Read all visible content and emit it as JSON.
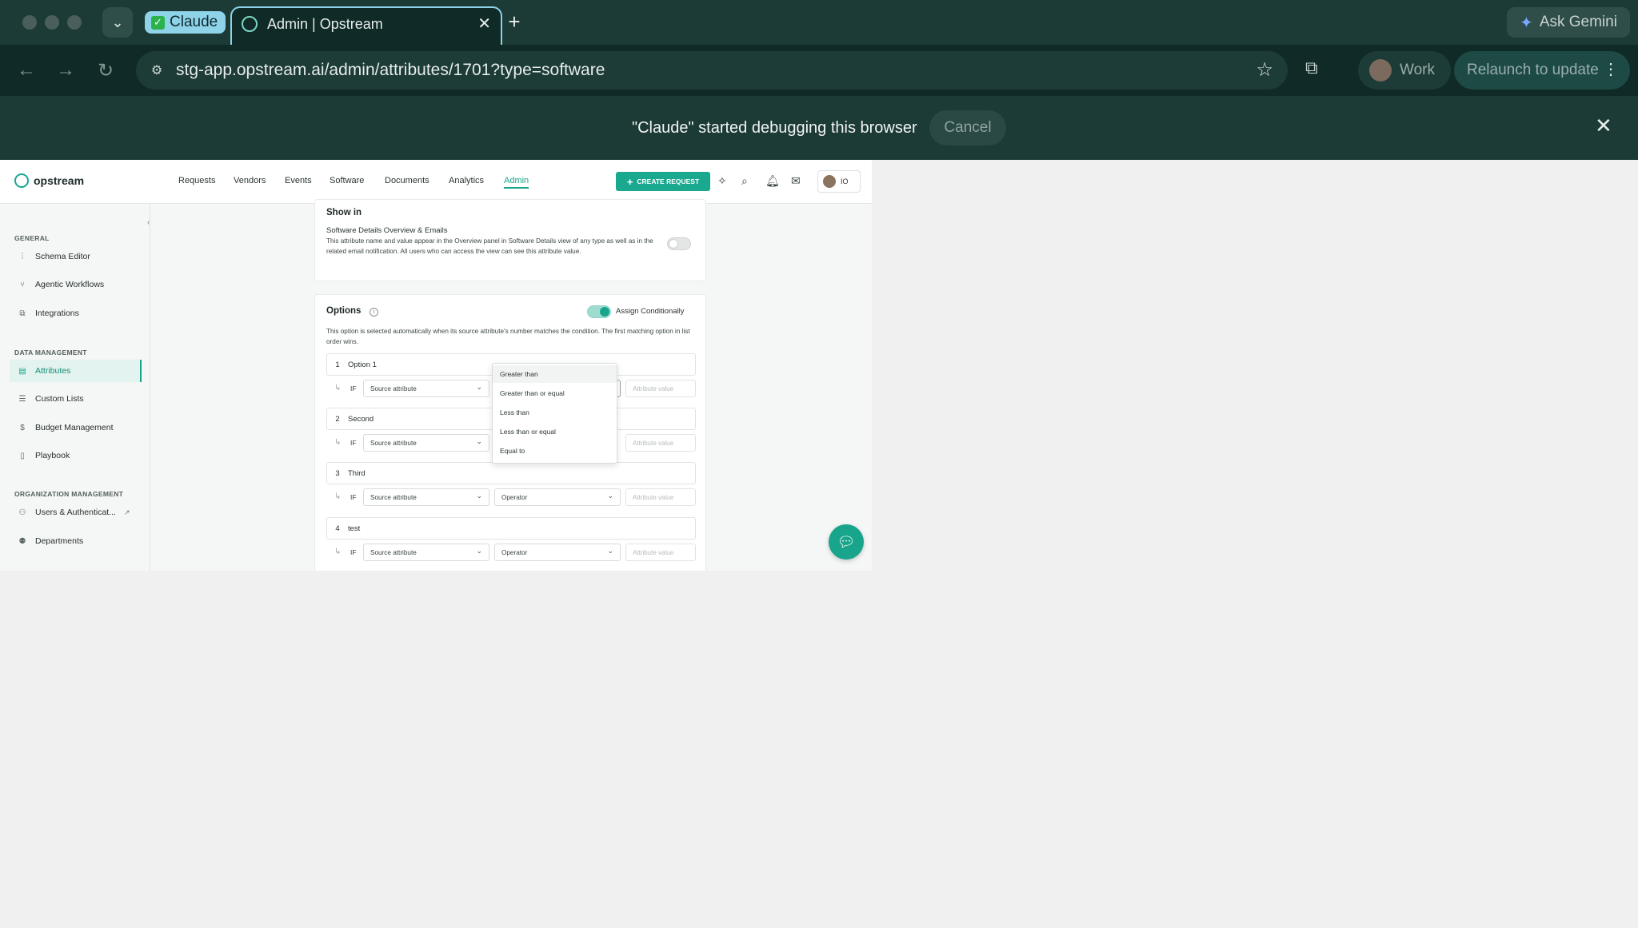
{
  "browser": {
    "tab_group_label": "Claude",
    "active_tab_title": "Admin | Opstream",
    "new_tab_symbol": "+",
    "ask_gemini_label": "Ask Gemini",
    "url": "stg-app.opstream.ai/admin/attributes/1701?type=software",
    "profile_label": "Work",
    "relaunch_label": "Relaunch to update",
    "infobar_message": "\"Claude\" started debugging this browser",
    "infobar_cancel": "Cancel"
  },
  "app": {
    "logo_text": "opstream",
    "nav": [
      "Requests",
      "Vendors",
      "Events",
      "Software",
      "Documents",
      "Analytics",
      "Admin"
    ],
    "active_nav": "Admin",
    "create_request_label": "CREATE REQUEST",
    "user_initials": "IO",
    "accent_color": "#18a58b"
  },
  "sidebar": {
    "sections": [
      {
        "title": "GENERAL",
        "items": [
          {
            "label": "Schema Editor",
            "icon": "sliders-icon"
          },
          {
            "label": "Agentic Workflows",
            "icon": "branch-icon"
          },
          {
            "label": "Integrations",
            "icon": "integrations-icon"
          }
        ]
      },
      {
        "title": "DATA MANAGEMENT",
        "items": [
          {
            "label": "Attributes",
            "icon": "database-icon",
            "active": true
          },
          {
            "label": "Custom Lists",
            "icon": "list-icon"
          },
          {
            "label": "Budget Management",
            "icon": "dollar-icon"
          },
          {
            "label": "Playbook",
            "icon": "book-icon"
          }
        ]
      },
      {
        "title": "ORGANIZATION MANAGEMENT",
        "items": [
          {
            "label": "Users & Authenticat...",
            "icon": "users-icon",
            "external": true
          },
          {
            "label": "Departments",
            "icon": "people-icon"
          }
        ]
      }
    ]
  },
  "show_in": {
    "heading": "Show in",
    "item_title": "Software Details Overview & Emails",
    "item_description": "This attribute name and value appear in the Overview panel in Software Details view of any type as well as in the related email notification. All users who can access the view can see this attribute value.",
    "enabled": false
  },
  "options": {
    "heading": "Options",
    "assign_label": "Assign Conditionally",
    "assign_enabled": true,
    "description": "This option is selected automatically when its source attribute's number matches the condition. The first matching option in list order wins.",
    "if_label": "IF",
    "source_placeholder": "Source attribute",
    "operator_placeholder": "Operator",
    "value_placeholder": "Attribute value",
    "rows": [
      {
        "num": "1",
        "name": "Option 1"
      },
      {
        "num": "2",
        "name": "Second"
      },
      {
        "num": "3",
        "name": "Third"
      },
      {
        "num": "4",
        "name": "test"
      }
    ],
    "operator_menu": [
      "Greater than",
      "Greater than or equal",
      "Less than",
      "Less than or equal",
      "Equal to"
    ]
  }
}
